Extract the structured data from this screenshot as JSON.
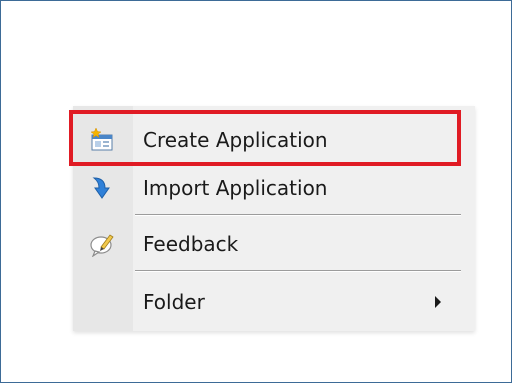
{
  "context_menu": {
    "items": [
      {
        "label": "Create Application",
        "icon": "create-application-icon",
        "highlighted": true
      },
      {
        "label": "Import Application",
        "icon": "import-arrow-icon"
      },
      {
        "label": "Feedback",
        "icon": "feedback-pencil-icon"
      },
      {
        "label": "Folder",
        "icon": "",
        "has_submenu": true
      }
    ]
  },
  "colors": {
    "highlight_border": "#e01b24",
    "menu_background": "#f0f0f0",
    "gutter_background": "#e7e7e7",
    "frame_border": "#3d6b97"
  }
}
